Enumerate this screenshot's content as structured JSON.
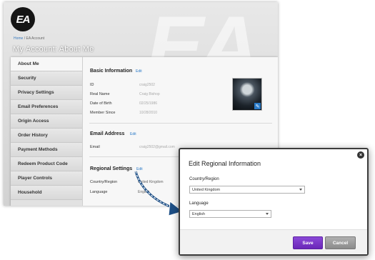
{
  "header": {
    "logo_text": "EA",
    "breadcrumb_home": "Home",
    "breadcrumb_sep": " / ",
    "breadcrumb_current": "EA Account",
    "page_title": "My Account: About Me"
  },
  "sidebar": {
    "items": [
      {
        "label": "About Me",
        "active": true
      },
      {
        "label": "Security"
      },
      {
        "label": "Privacy Settings"
      },
      {
        "label": "Email Preferences"
      },
      {
        "label": "Origin Access"
      },
      {
        "label": "Order History"
      },
      {
        "label": "Payment Methods"
      },
      {
        "label": "Redeem Product Code"
      },
      {
        "label": "Player Controls"
      },
      {
        "label": "Household"
      }
    ]
  },
  "basic_info": {
    "title": "Basic Information",
    "edit": "Edit",
    "fields": [
      {
        "label": "ID",
        "value": "craig2502"
      },
      {
        "label": "Real Name",
        "value": "Craig Bishop"
      },
      {
        "label": "Date of Birth",
        "value": "02/25/1986"
      },
      {
        "label": "Member Since",
        "value": "10/28/2010"
      }
    ]
  },
  "email": {
    "title": "Email Address",
    "edit": "Edit",
    "label": "Email",
    "value": "craig2502@gmail.com"
  },
  "regional": {
    "title": "Regional Settings",
    "edit": "Edit",
    "fields": [
      {
        "label": "Country/Region",
        "value": "United Kingdom"
      },
      {
        "label": "Language",
        "value": "English"
      }
    ]
  },
  "modal": {
    "title": "Edit Regional Information",
    "close": "×",
    "country_label": "Country/Region",
    "country_value": "United Kingdom",
    "language_label": "Language",
    "language_value": "English",
    "save_label": "Save",
    "cancel_label": "Cancel"
  },
  "colors": {
    "accent_link": "#2a7ac7",
    "save_button": "#7a35c8",
    "cancel_button": "#9c9c9c"
  }
}
